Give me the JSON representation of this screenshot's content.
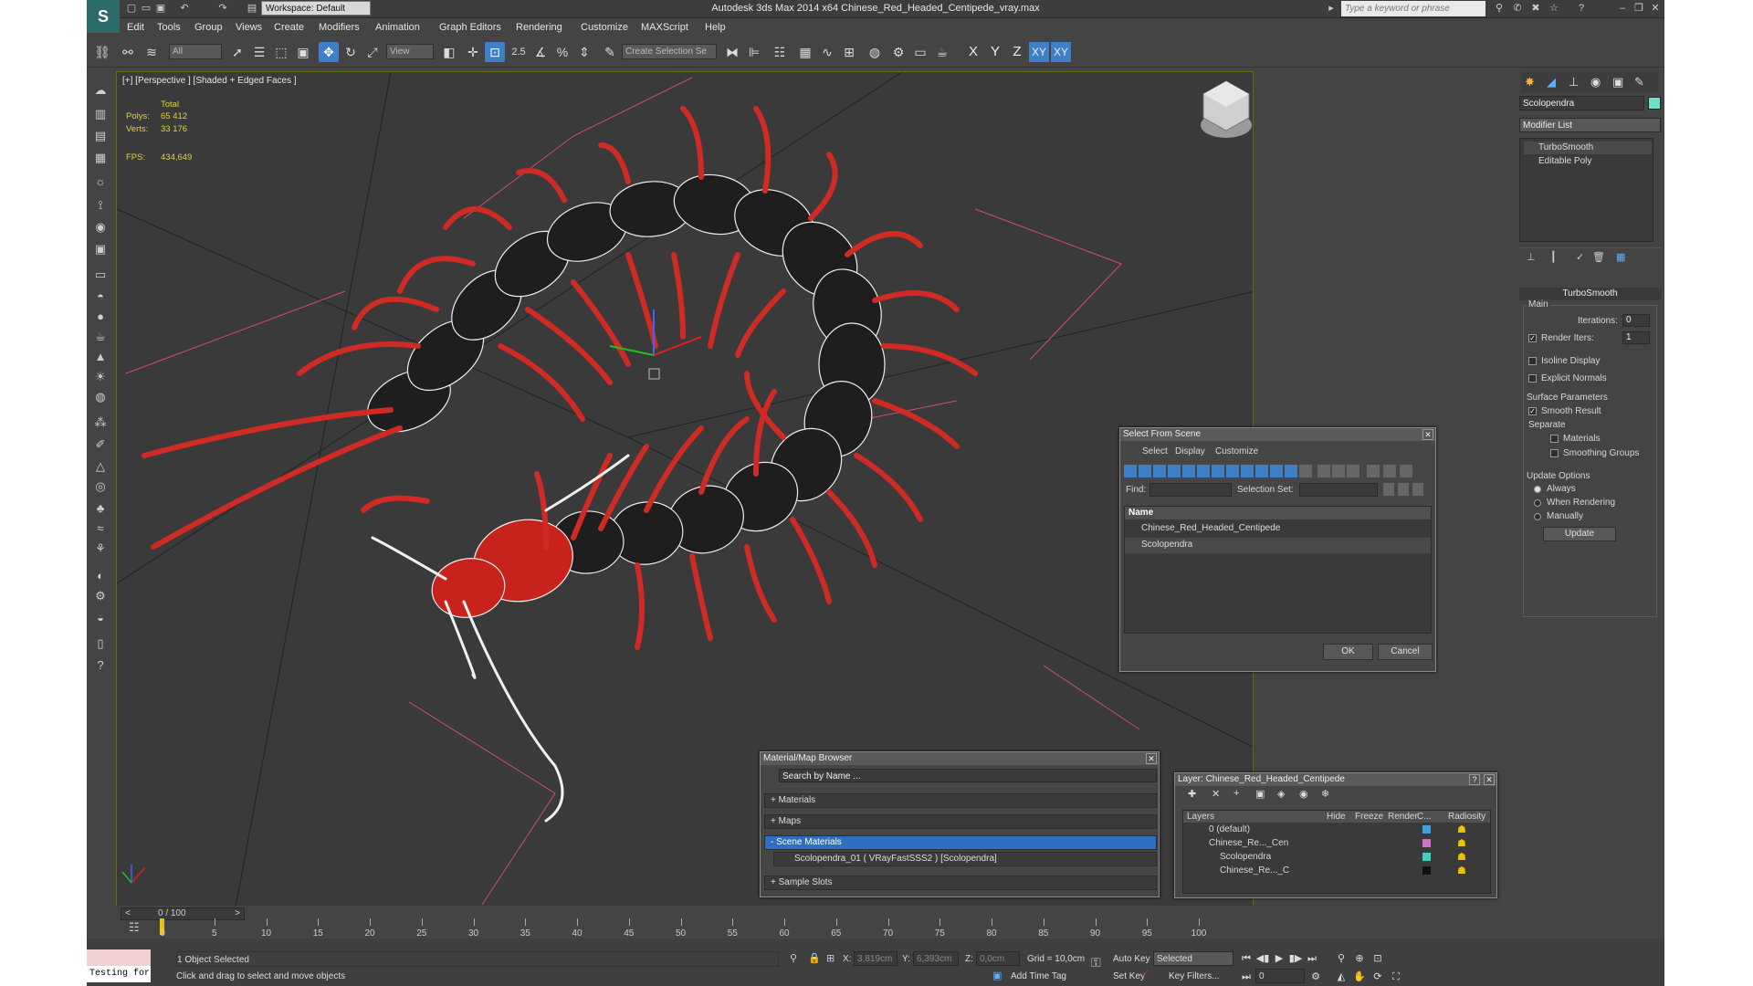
{
  "title_bar": {
    "logo": "S",
    "title": "Autodesk 3ds Max  2014 x64      Chinese_Red_Headed_Centipede_vray.max",
    "workspace": "Workspace: Default",
    "search_placeholder": "Type a keyword or phrase"
  },
  "menu": [
    "Edit",
    "Tools",
    "Group",
    "Views",
    "Create",
    "Modifiers",
    "Animation",
    "Graph Editors",
    "Rendering",
    "Customize",
    "MAXScript",
    "Help"
  ],
  "toolbar": {
    "filter_dropdown": "All",
    "refcoord_dropdown": "View",
    "snap_label": "2.5",
    "named_selection": "Create Selection Se",
    "axis_x": "X",
    "axis_y": "Y",
    "axis_z": "Z",
    "axis_xy": "XY",
    "axis_xy2": "XY"
  },
  "viewport": {
    "label": "[+] [Perspective ] [Shaded + Edged Faces ]",
    "stats_header": "Total",
    "polys_label": "Polys:",
    "polys_value": "65 412",
    "verts_label": "Verts:",
    "verts_value": "33 176",
    "fps_label": "FPS:",
    "fps_value": "434,649"
  },
  "command_panel": {
    "object_name": "Scolopendra",
    "object_color": "#6fe0c8",
    "modifier_list": "Modifier List",
    "stack": [
      "TurboSmooth",
      "Editable Poly"
    ],
    "rollout_title": "TurboSmooth",
    "main_label": "Main",
    "iterations_label": "Iterations:",
    "iterations_value": "0",
    "render_iters_label": "Render Iters:",
    "render_iters_value": "1",
    "isoline": "Isoline Display",
    "explicit_normals": "Explicit Normals",
    "surface_params": "Surface Parameters",
    "smooth_result": "Smooth Result",
    "separate": "Separate",
    "materials": "Materials",
    "smoothing_groups": "Smoothing Groups",
    "update_options": "Update Options",
    "always": "Always",
    "when_rendering": "When Rendering",
    "manually": "Manually",
    "update_button": "Update"
  },
  "select_from_scene": {
    "title": "Select From Scene",
    "menu": [
      "Select",
      "Display",
      "Customize"
    ],
    "find_label": "Find:",
    "selection_set_label": "Selection Set:",
    "column_name": "Name",
    "items": [
      "Chinese_Red_Headed_Centipede",
      "Scolopendra"
    ],
    "ok": "OK",
    "cancel": "Cancel"
  },
  "material_browser": {
    "title": "Material/Map Browser",
    "search_placeholder": "Search by Name ...",
    "materials": "+ Materials",
    "maps": "+ Maps",
    "scene_materials": "- Scene Materials",
    "scene_item": "Scolopendra_01  ( VRayFastSSS2 )  [Scolopendra]",
    "sample_slots": "+ Sample Slots"
  },
  "layer_dialog": {
    "title": "Layer: Chinese_Red_Headed_Centipede",
    "help": "?",
    "columns": [
      "Layers",
      "Hide",
      "Freeze",
      "Render",
      "C...",
      "Radiosity"
    ],
    "rows": [
      {
        "name": "0 (default)",
        "color": "#3fa0e0"
      },
      {
        "name": "Chinese_Re..._Cen",
        "color": "#d070d0"
      },
      {
        "name": "Scolopendra",
        "color": "#40d0c0"
      },
      {
        "name": "Chinese_Re..._C",
        "color": "#111111"
      }
    ]
  },
  "timeline": {
    "frame_counter": "0 / 100",
    "ticks": [
      "0",
      "5",
      "10",
      "15",
      "20",
      "25",
      "30",
      "35",
      "40",
      "45",
      "50",
      "55",
      "60",
      "65",
      "70",
      "75",
      "80",
      "85",
      "90",
      "95",
      "100"
    ]
  },
  "status_bar": {
    "maxscript_text": "Testing for :",
    "objects_selected": "1 Object Selected",
    "prompt": "Click and drag to select and move objects",
    "x_label": "X:",
    "x_value": "3,819cm",
    "y_label": "Y:",
    "y_value": "6,393cm",
    "z_label": "Z:",
    "z_value": "0,0cm",
    "grid": "Grid = 10,0cm",
    "add_time_tag": "Add Time Tag",
    "auto_key": "Auto Key",
    "selected_dropdown": "Selected",
    "set_key": "Set Key",
    "key_filters": "Key Filters...",
    "current_frame": "0"
  }
}
